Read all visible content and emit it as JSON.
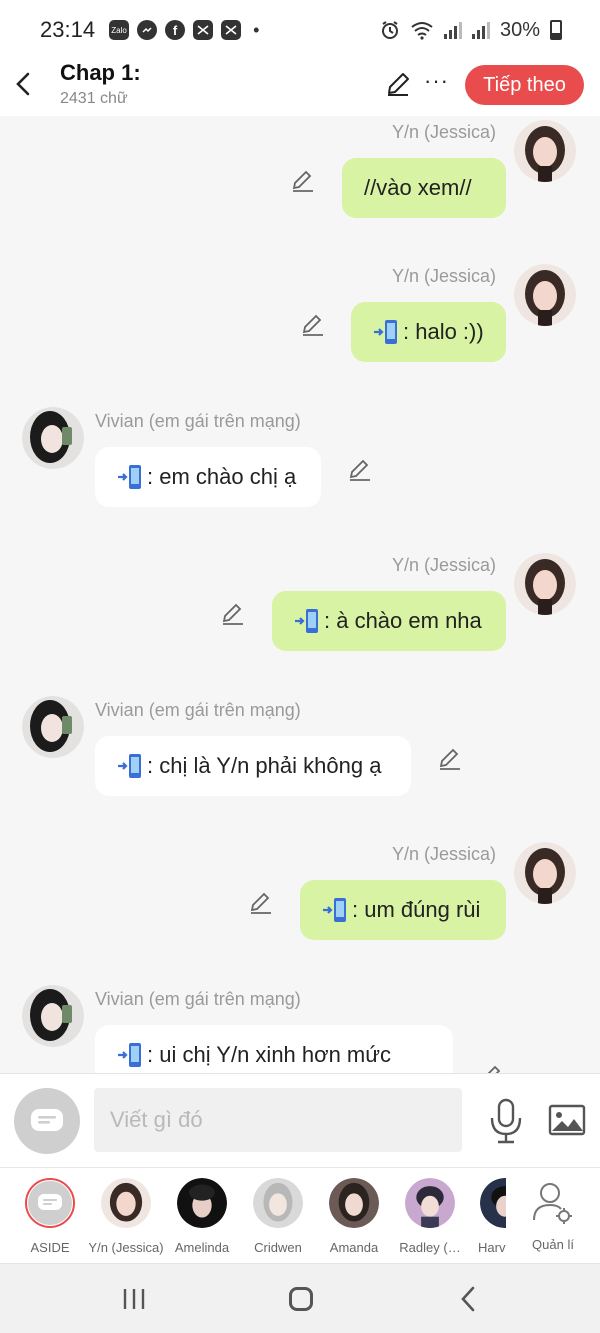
{
  "status_bar": {
    "time": "23:14",
    "app_icons": [
      "zalo-icon",
      "messenger-icon",
      "facebook-icon",
      "capcut-icon",
      "capcut-icon"
    ],
    "battery": "30%"
  },
  "header": {
    "title": "Chap 1:",
    "subtitle": "2431 chữ",
    "next_label": "Tiếp theo",
    "accent": "#e84c4c"
  },
  "messages": [
    {
      "side": "me",
      "name": "Y/n (Jessica)",
      "text": "//vào xem//",
      "has_phone": false
    },
    {
      "side": "me",
      "name": "Y/n (Jessica)",
      "text": ": halo :))",
      "has_phone": true
    },
    {
      "side": "them",
      "name": "Vivian (em gái trên mạng)",
      "text": ": em chào chị ạ",
      "has_phone": true
    },
    {
      "side": "me",
      "name": "Y/n (Jessica)",
      "text": ": à chào em nha",
      "has_phone": true
    },
    {
      "side": "them",
      "name": "Vivian (em gái trên mạng)",
      "text": ": chị là Y/n phải không ạ",
      "has_phone": true
    },
    {
      "side": "me",
      "name": "Y/n (Jessica)",
      "text": ": um đúng rùi",
      "has_phone": true
    },
    {
      "side": "them",
      "name": "Vivian (em gái trên mạng)",
      "text": ": ui chị Y/n xinh hơn mức",
      "has_phone": true
    }
  ],
  "composer": {
    "placeholder": "Viết gì đó"
  },
  "characters": [
    {
      "label": "ASIDE"
    },
    {
      "label": "Y/n (Jessica)"
    },
    {
      "label": "Amelinda"
    },
    {
      "label": "Cridwen"
    },
    {
      "label": "Amanda"
    },
    {
      "label": "Radley (…"
    },
    {
      "label": "Harvey"
    },
    {
      "label": "Quản lí"
    }
  ],
  "colors": {
    "me_bubble": "#d8f3a3",
    "them_bubble": "#ffffff",
    "background": "#f6f6f6"
  }
}
